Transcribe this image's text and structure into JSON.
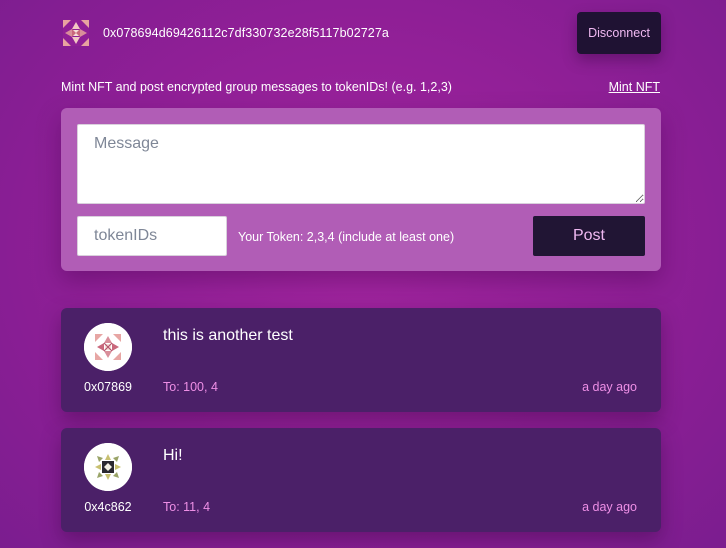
{
  "header": {
    "address": "0x078694d69426112c7df330732e28f5117b02727a",
    "avatar_icon": "user-identicon",
    "disconnect_label": "Disconnect"
  },
  "intro": {
    "text": "Mint NFT and post encrypted group messages to tokenIDs! (e.g. 1,2,3)",
    "mint_link": "Mint NFT"
  },
  "composer": {
    "message_placeholder": "Message",
    "message_value": "",
    "tokenids_placeholder": "tokenIDs",
    "tokenids_value": "",
    "your_token_text": "Your Token: 2,3,4 (include at least one)",
    "post_label": "Post"
  },
  "posts": [
    {
      "author": "0x07869",
      "text": "this is another test",
      "to": "To: 100, 4",
      "time": "a day ago",
      "avatar_icon": "author-identicon"
    },
    {
      "author": "0x4c862",
      "text": "Hi!",
      "to": "To: 11, 4",
      "time": "a day ago",
      "avatar_icon": "author-identicon"
    }
  ],
  "colors": {
    "background": "#961f98",
    "composer_bg": "#b15db6",
    "card_bg": "#4b2068",
    "button_bg": "#211534",
    "button_text": "#f0b9f2",
    "accent_text": "#ee8fe6"
  }
}
